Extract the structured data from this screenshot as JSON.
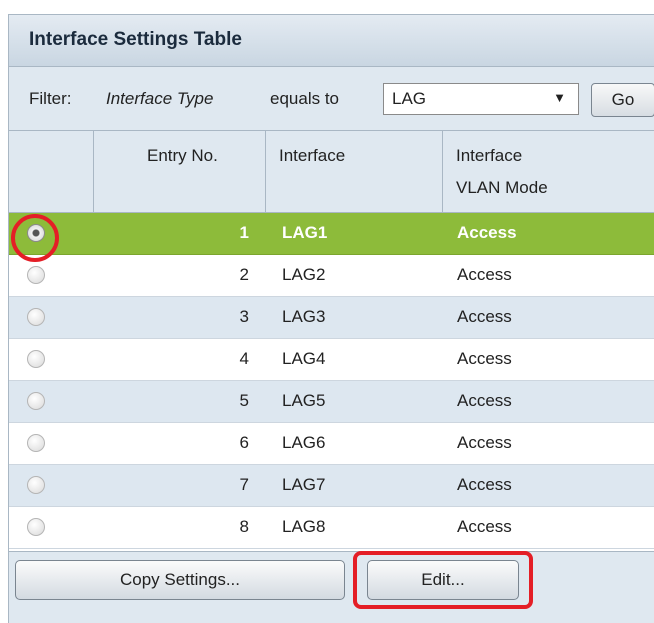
{
  "panel": {
    "title": "Interface Settings Table"
  },
  "filter": {
    "label": "Filter:",
    "field": "Interface Type",
    "operator": "equals to",
    "selected_value": "LAG",
    "dropdown_arrow": "▼",
    "go_label": "Go"
  },
  "table": {
    "columns": [
      "Entry No.",
      "Interface",
      "Interface",
      "VLAN Mode"
    ],
    "rows": [
      {
        "entry": "1",
        "interface": "LAG1",
        "mode": "Access",
        "selected": true
      },
      {
        "entry": "2",
        "interface": "LAG2",
        "mode": "Access",
        "selected": false
      },
      {
        "entry": "3",
        "interface": "LAG3",
        "mode": "Access",
        "selected": false
      },
      {
        "entry": "4",
        "interface": "LAG4",
        "mode": "Access",
        "selected": false
      },
      {
        "entry": "5",
        "interface": "LAG5",
        "mode": "Access",
        "selected": false
      },
      {
        "entry": "6",
        "interface": "LAG6",
        "mode": "Access",
        "selected": false
      },
      {
        "entry": "7",
        "interface": "LAG7",
        "mode": "Access",
        "selected": false
      },
      {
        "entry": "8",
        "interface": "LAG8",
        "mode": "Access",
        "selected": false
      }
    ]
  },
  "actions": {
    "copy_label": "Copy Settings...",
    "edit_label": "Edit..."
  },
  "colors": {
    "selected_row": "#8dbb3a",
    "alt_row": "#dde7f0",
    "highlight": "#e41e26"
  }
}
